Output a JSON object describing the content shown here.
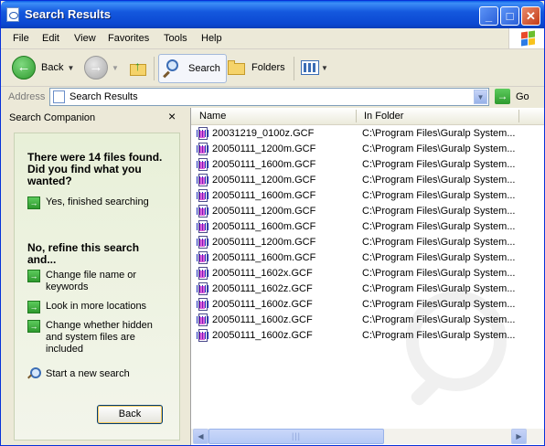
{
  "window": {
    "title": "Search Results",
    "min_glyph": "_",
    "max_glyph": "□",
    "close_glyph": "✕"
  },
  "menu": [
    "File",
    "Edit",
    "View",
    "Favorites",
    "Tools",
    "Help"
  ],
  "toolbar": {
    "back_label": "Back",
    "search_label": "Search",
    "folders_label": "Folders"
  },
  "address": {
    "label": "Address",
    "value": "Search Results",
    "go_label": "Go"
  },
  "companion": {
    "title": "Search Companion",
    "close_glyph": "×",
    "found_text": "There were 14 files found. Did you find what you wanted?",
    "opt_yes": "Yes, finished searching",
    "refine_text": "No, refine this search and...",
    "opt_change_name": "Change file name or keywords",
    "opt_more_locations": "Look in more locations",
    "opt_hidden": "Change whether hidden and system files are included",
    "new_search": "Start a new search",
    "back_button": "Back"
  },
  "list": {
    "columns": [
      "Name",
      "In Folder"
    ],
    "rows": [
      {
        "name": "20031219_0100z.GCF",
        "folder": "C:\\Program Files\\Guralp System..."
      },
      {
        "name": "20050111_1200m.GCF",
        "folder": "C:\\Program Files\\Guralp System..."
      },
      {
        "name": "20050111_1600m.GCF",
        "folder": "C:\\Program Files\\Guralp System..."
      },
      {
        "name": "20050111_1200m.GCF",
        "folder": "C:\\Program Files\\Guralp System..."
      },
      {
        "name": "20050111_1600m.GCF",
        "folder": "C:\\Program Files\\Guralp System..."
      },
      {
        "name": "20050111_1200m.GCF",
        "folder": "C:\\Program Files\\Guralp System..."
      },
      {
        "name": "20050111_1600m.GCF",
        "folder": "C:\\Program Files\\Guralp System..."
      },
      {
        "name": "20050111_1200m.GCF",
        "folder": "C:\\Program Files\\Guralp System..."
      },
      {
        "name": "20050111_1600m.GCF",
        "folder": "C:\\Program Files\\Guralp System..."
      },
      {
        "name": "20050111_1602x.GCF",
        "folder": "C:\\Program Files\\Guralp System..."
      },
      {
        "name": "20050111_1602z.GCF",
        "folder": "C:\\Program Files\\Guralp System..."
      },
      {
        "name": "20050111_1600z.GCF",
        "folder": "C:\\Program Files\\Guralp System..."
      },
      {
        "name": "20050111_1600z.GCF",
        "folder": "C:\\Program Files\\Guralp System..."
      },
      {
        "name": "20050111_1600z.GCF",
        "folder": "C:\\Program Files\\Guralp System..."
      }
    ]
  },
  "colors": {
    "titlebar": "#0B48D1",
    "companion_panel": "#E8F0D8",
    "accent_green": "#2E9A2E"
  }
}
